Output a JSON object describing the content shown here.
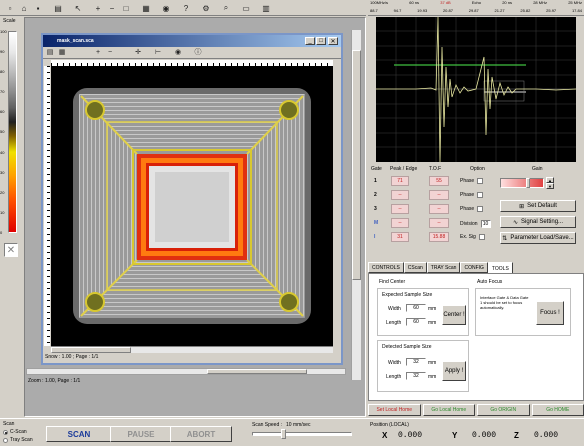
{
  "toolbar": {
    "icons": [
      "new-icon",
      "open-icon",
      "save-icon",
      "print-icon",
      "pointer-icon",
      "zoom-in-icon",
      "zoom-out-icon",
      "fit-icon",
      "grid-icon",
      "camera-icon",
      "help-icon"
    ]
  },
  "scale": {
    "label": "Scale",
    "ticks": [
      "100",
      "90",
      "80",
      "70",
      "60",
      "50",
      "40",
      "30",
      "20",
      "10",
      "0"
    ]
  },
  "image_window": {
    "title": "mask_scan.sca",
    "status_left": "Zoom : 1.00, Page : 1/1",
    "caption": "Snow : 1.00 ; Page : 1/1"
  },
  "scope": {
    "header_labels": [
      "100MHz/s",
      "60 ns",
      "37 dB",
      "Echo",
      "20 ns",
      "28 MHz",
      "25 MHz"
    ],
    "header_values": [
      "88.7",
      "94.7",
      "19.93",
      "20.87",
      "29.87",
      "21.27",
      "25.82",
      "25.97",
      "17.84"
    ]
  },
  "gates": {
    "col_gate": "Gate",
    "col_peak": "Peak / Edge",
    "col_tof": "T.O.F",
    "rows": [
      {
        "num": "1",
        "peak": "71",
        "tof": "55"
      },
      {
        "num": "2",
        "peak": "--",
        "tof": "--"
      },
      {
        "num": "3",
        "peak": "--",
        "tof": "--"
      },
      {
        "num": "M",
        "peak": "--",
        "tof": "--"
      },
      {
        "num": "I",
        "peak": "31",
        "tof": "15.88"
      }
    ]
  },
  "options": {
    "title": "Option",
    "phase_label": "Phase",
    "division_label": "Division",
    "division_value": "10",
    "ex_sig_label": "Ex. Sig"
  },
  "gain": {
    "title": "Gain",
    "level": 0.62
  },
  "buttons": {
    "set_default": "Set Default",
    "signal_setting": "Signal Setting...",
    "parameter_load": "Parameter Load/Save..."
  },
  "tabs": [
    "CONTROLS",
    "CScan",
    "TRAY Scan",
    "CONFIG",
    "TOOLS"
  ],
  "tools": {
    "find_center": "Find Center",
    "expected_size": "Expected Sample Size",
    "width_label": "Width",
    "width_value": "60",
    "length_label": "Length",
    "length_value": "60",
    "unit": "mm",
    "center_button": "Center !",
    "detected_size": "Detected Sample Size",
    "det_width_value": "32",
    "det_length_value": "32",
    "apply_button": "Apply !",
    "auto_focus": "Auto Focus",
    "focus_note": "Interface Gate & Data Gate 1 should be set to focus automatically.",
    "focus_button": "Focus !"
  },
  "bottom_buttons": {
    "set_local_home": "Set Local Home",
    "go_local_home": "Go Local Home",
    "go_origin": "Go ORIGIN",
    "go_home": "Go HOME"
  },
  "position": {
    "title": "Position (LOCAL)",
    "x_label": "X",
    "x_value": "0.000",
    "y_label": "Y",
    "y_value": "0.000",
    "z_label": "Z",
    "z_value": "0.000"
  },
  "scan_mode": {
    "label": "Scan",
    "option_cscan": "C-Scan",
    "option_tray": "Tray Scan",
    "selected": "C-Scan"
  },
  "scan_controls": {
    "scan": "SCAN",
    "pause": "PAUSE",
    "abort": "ABORT",
    "speed_label": "Scan Speed :",
    "speed_value": "10 mm/sec",
    "speed_level": 0.3
  },
  "colors": {
    "accent_green": "#50a050",
    "accent_red": "#c02020",
    "scope_bg": "#000000",
    "tab_active": "#ffffff"
  }
}
